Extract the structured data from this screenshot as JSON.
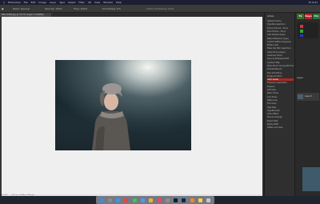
{
  "menubar": {
    "apple": "",
    "items": [
      "Photoshop",
      "File",
      "Edit",
      "Image",
      "Layer",
      "Type",
      "Select",
      "Filter",
      "3D",
      "View",
      "Window",
      "Help"
    ],
    "status": [
      "Fri 9:41"
    ]
  },
  "options_bar": {
    "items": [
      "Mode: Normal",
      "Opacity: 100%",
      "Flow: 100%",
      "Smoothing: 0%"
    ]
  },
  "window_title": "Adobe Photoshop 2022",
  "document_tab": {
    "label": "IMG_8428.jpg @ 33.3% (Layer 0, RGB/8)"
  },
  "status_bar": {
    "zoom": "33.33%",
    "info": "5472 px x 3648 px (240 ppi)"
  },
  "actions_panel": {
    "header": "Actions",
    "items": [
      "Default Actions",
      "Vignette (selection)",
      "Frame Channel - 50 px",
      "Wood Frame - 50 px",
      "Cast Shadow (type)",
      "Water Reflection (type)",
      "Custom RGB to Grayscale",
      "Molten Lead",
      "Make Clip Path (selection)",
      "Sepia Toning (layer)",
      "Quadrant Colors",
      "Save As Photoshop PDF",
      "Gradient Map",
      "Mixer Brush Cloning Paint Setup",
      "Portrait Retouch",
      "Skin Smoothing",
      "Dodge and Burn",
      "Color Grade",
      "Frequency Separation",
      "Sharpen",
      "Soft Glow",
      "Warm Tones",
      "Cool Tones",
      "Matte Look",
      "Film Grain",
      "High Pass",
      "Vignette Dark",
      "Orton Effect",
      "Teal and Orange",
      "Export Web",
      "Resize 2048",
      "Flatten and Save"
    ],
    "selected_index": 17
  },
  "right_panel": {
    "badges": [
      {
        "text": "Tk",
        "color": "#3f6b2b"
      },
      {
        "text": "Raya",
        "color": "#b3261e"
      },
      {
        "text": "Pro",
        "color": "#2c6e3a"
      }
    ],
    "layers_header": "Layers",
    "layer_name": "Layer 0"
  },
  "colors": {
    "accent_selected": "#b3261e",
    "menubar_bg": "#1c1f33",
    "canvas_bg": "#efefef",
    "panel_bg": "#2f2f2f"
  },
  "dock": {
    "icons": [
      {
        "name": "finder-icon",
        "color": "#3a8fe0"
      },
      {
        "name": "launchpad-icon",
        "color": "#8a8a8a"
      },
      {
        "name": "safari-icon",
        "color": "#2d9bf0"
      },
      {
        "name": "chrome-icon",
        "color": "#e8453c"
      },
      {
        "name": "messages-icon",
        "color": "#3cc45a"
      },
      {
        "name": "mail-icon",
        "color": "#4a9ef0"
      },
      {
        "name": "photos-icon",
        "color": "#f0b030"
      },
      {
        "name": "music-icon",
        "color": "#f2445a"
      },
      {
        "name": "settings-icon",
        "color": "#8e8e93"
      },
      {
        "name": "photoshop-icon",
        "color": "#001e36"
      },
      {
        "name": "lightroom-icon",
        "color": "#0a2a4a"
      },
      {
        "name": "vlc-icon",
        "color": "#f08a1c"
      },
      {
        "name": "notes-icon",
        "color": "#f5d442"
      },
      {
        "name": "trash-icon",
        "color": "#c8c8c8"
      }
    ]
  }
}
